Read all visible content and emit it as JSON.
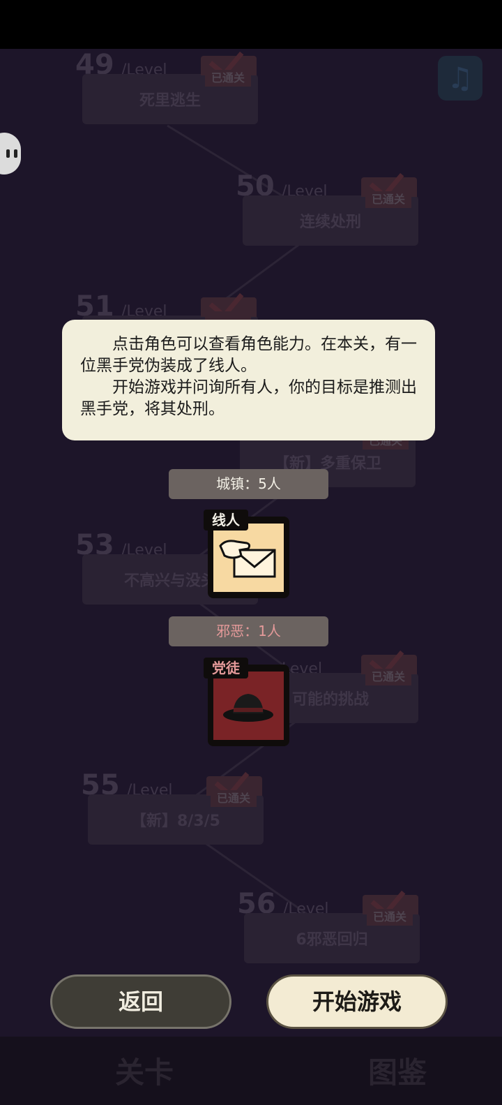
{
  "levels": [
    {
      "num": "49",
      "tag": "/Level",
      "name": "死里逃生",
      "stamp": "已通关"
    },
    {
      "num": "50",
      "tag": "/Level",
      "name": "连续处刑",
      "stamp": "已通关"
    },
    {
      "num": "51",
      "tag": "/Level",
      "name": "",
      "stamp": ""
    },
    {
      "num": "",
      "tag": "",
      "name": "【新】多重保卫",
      "stamp": "已通关"
    },
    {
      "num": "53",
      "tag": "/Level",
      "name": "不高兴与没头",
      "stamp": ""
    },
    {
      "num": "",
      "tag": "Level",
      "name": "可能的挑战",
      "stamp": "已通关"
    },
    {
      "num": "55",
      "tag": "/Level",
      "name": "【新】8/3/5",
      "stamp": "已通关"
    },
    {
      "num": "56",
      "tag": "/Level",
      "name": "6邪恶回归",
      "stamp": "已通关"
    }
  ],
  "modal": {
    "para1": "点击角色可以查看角色能力。在本关，有一位黑手党伪装成了线人。",
    "para2": "开始游戏并问询所有人，你的目标是推测出黑手党，将其处刑。"
  },
  "town": {
    "label": "城镇：5人",
    "role": "线人",
    "color": "#f3f0e6"
  },
  "evil": {
    "label": "邪恶：1人",
    "role": "党徒",
    "color": "#e59a9a"
  },
  "buttons": {
    "back": "返回",
    "start": "开始游戏"
  },
  "tabs": {
    "levels": "关卡",
    "codex": "图鉴"
  },
  "icons": {
    "music": "music-note-icon",
    "ghost": "ghost-icon",
    "informant": "hand-envelope-icon",
    "mafia": "fedora-hat-icon"
  }
}
